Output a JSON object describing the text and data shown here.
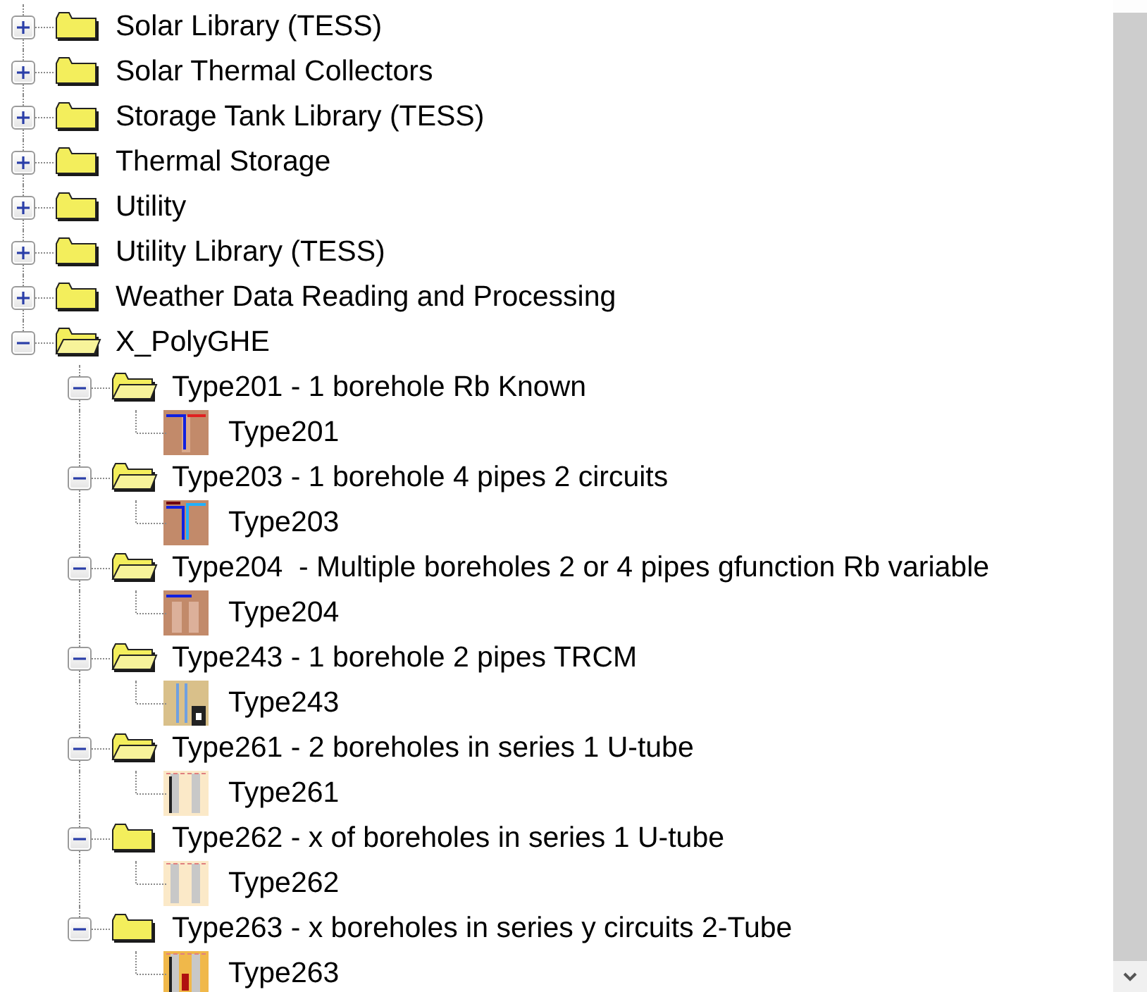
{
  "tree": [
    {
      "kind": "folder",
      "label": "Solar Library (TESS)",
      "expanded": false
    },
    {
      "kind": "folder",
      "label": "Solar Thermal Collectors",
      "expanded": false
    },
    {
      "kind": "folder",
      "label": "Storage Tank Library (TESS)",
      "expanded": false
    },
    {
      "kind": "folder",
      "label": "Thermal Storage",
      "expanded": false
    },
    {
      "kind": "folder",
      "label": "Utility",
      "expanded": false
    },
    {
      "kind": "folder",
      "label": "Utility Library (TESS)",
      "expanded": false
    },
    {
      "kind": "folder",
      "label": "Weather Data Reading and Processing",
      "expanded": false
    },
    {
      "kind": "folder",
      "label": "X_PolyGHE",
      "expanded": true,
      "children": [
        {
          "kind": "folder",
          "label": "Type201 - 1 borehole Rb Known",
          "expanded": true,
          "children": [
            {
              "kind": "component",
              "label": "Type201"
            }
          ]
        },
        {
          "kind": "folder",
          "label": "Type203 - 1 borehole 4 pipes 2 circuits",
          "expanded": true,
          "children": [
            {
              "kind": "component",
              "label": "Type203"
            }
          ]
        },
        {
          "kind": "folder",
          "label": "Type204  - Multiple boreholes 2 or 4 pipes gfunction Rb variable",
          "expanded": true,
          "children": [
            {
              "kind": "component",
              "label": "Type204"
            }
          ]
        },
        {
          "kind": "folder",
          "label": "Type243 - 1 borehole 2 pipes TRCM",
          "expanded": true,
          "children": [
            {
              "kind": "component",
              "label": "Type243"
            }
          ]
        },
        {
          "kind": "folder",
          "label": "Type261 - 2 boreholes in series 1 U-tube",
          "expanded": true,
          "children": [
            {
              "kind": "component",
              "label": "Type261"
            }
          ]
        },
        {
          "kind": "folder",
          "label": "Type262 - x of boreholes in series 1 U-tube",
          "expanded": true,
          "children": [
            {
              "kind": "component",
              "label": "Type262"
            }
          ]
        },
        {
          "kind": "folder",
          "label": "Type263 - x boreholes in series y circuits 2-Tube",
          "expanded": true,
          "children": [
            {
              "kind": "component",
              "label": "Type263"
            }
          ]
        }
      ]
    }
  ]
}
